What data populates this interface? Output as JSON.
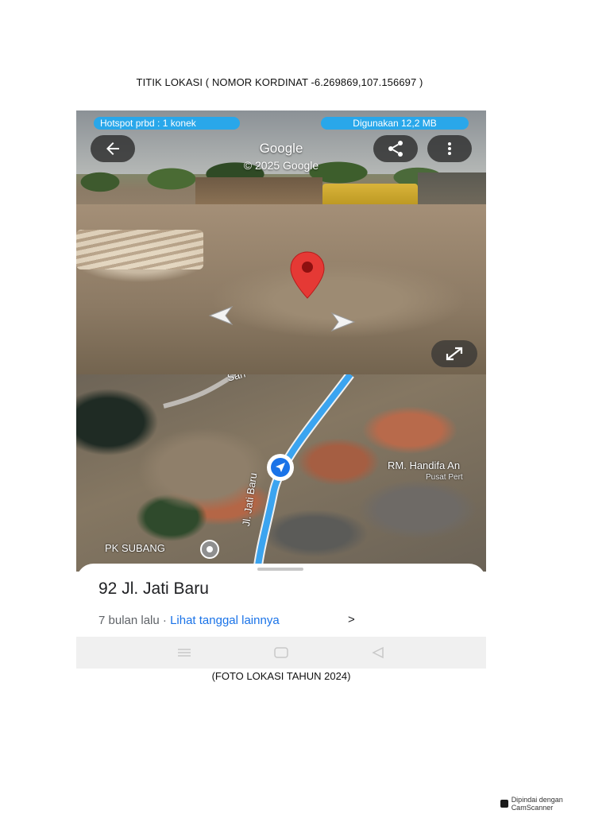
{
  "document": {
    "title": "TITIK LOKASI ( NOMOR KORDINAT -6.269869,107.156697 )",
    "caption": "(FOTO LOKASI TAHUN 2024)",
    "scanner_badge": "Dipindai dengan CamScanner"
  },
  "status_bar": {
    "hotspot": "Hotspot prbd : 1 konek",
    "usage": "Digunakan 12,2 MB"
  },
  "street_view": {
    "brand": "Google",
    "copyright": "© 2025 Google",
    "back_icon": "arrow-left-icon",
    "share_icon": "share-icon",
    "more_icon": "more-vertical-icon",
    "expand_icon": "expand-icon",
    "pin_color": "#e53935"
  },
  "map": {
    "street_top": "Sari",
    "street_vertical": "Jl. Jati Baru",
    "place_name": "RM. Handifa An",
    "place_sub": "Pusat Pert",
    "poi": "PK SUBANG",
    "route_color": "#3ba4f0"
  },
  "sheet": {
    "address": "92 Jl. Jati Baru",
    "time_ago": "7 bulan lalu · ",
    "link": "Lihat tanggal lainnya",
    "chevron": ">"
  },
  "colors": {
    "accent": "#29a7ea",
    "link": "#1a73e8"
  }
}
